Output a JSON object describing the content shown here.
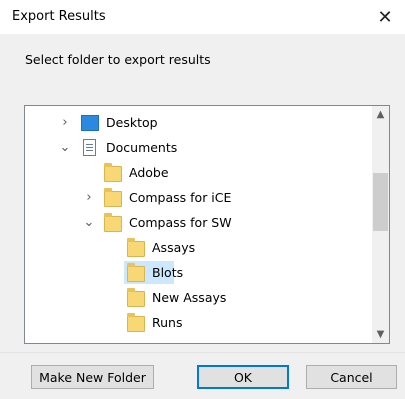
{
  "window": {
    "title": "Export Results",
    "close_glyph": "✕"
  },
  "instruction": "Select folder to export results",
  "tree": {
    "items": [
      {
        "label": "Desktop",
        "icon": "desktop-icon",
        "expander": "collapsed"
      },
      {
        "label": "Documents",
        "icon": "document-icon",
        "expander": "expanded"
      },
      {
        "label": "Adobe",
        "icon": "folder-icon",
        "expander": "none"
      },
      {
        "label": "Compass for iCE",
        "icon": "folder-icon",
        "expander": "collapsed"
      },
      {
        "label": "Compass for SW",
        "icon": "folder-icon",
        "expander": "expanded"
      },
      {
        "label": "Assays",
        "icon": "folder-icon",
        "expander": "none"
      },
      {
        "label": "Blots",
        "icon": "folder-icon",
        "expander": "none",
        "selected": true
      },
      {
        "label": "New Assays",
        "icon": "folder-icon",
        "expander": "none"
      },
      {
        "label": "Runs",
        "icon": "folder-icon",
        "expander": "none"
      }
    ]
  },
  "buttons": {
    "make_new_folder": "Make New Folder",
    "ok": "OK",
    "cancel": "Cancel"
  },
  "colors": {
    "selection": "#cce8ff",
    "folder": "#f8d775",
    "accent": "#0078d7"
  }
}
